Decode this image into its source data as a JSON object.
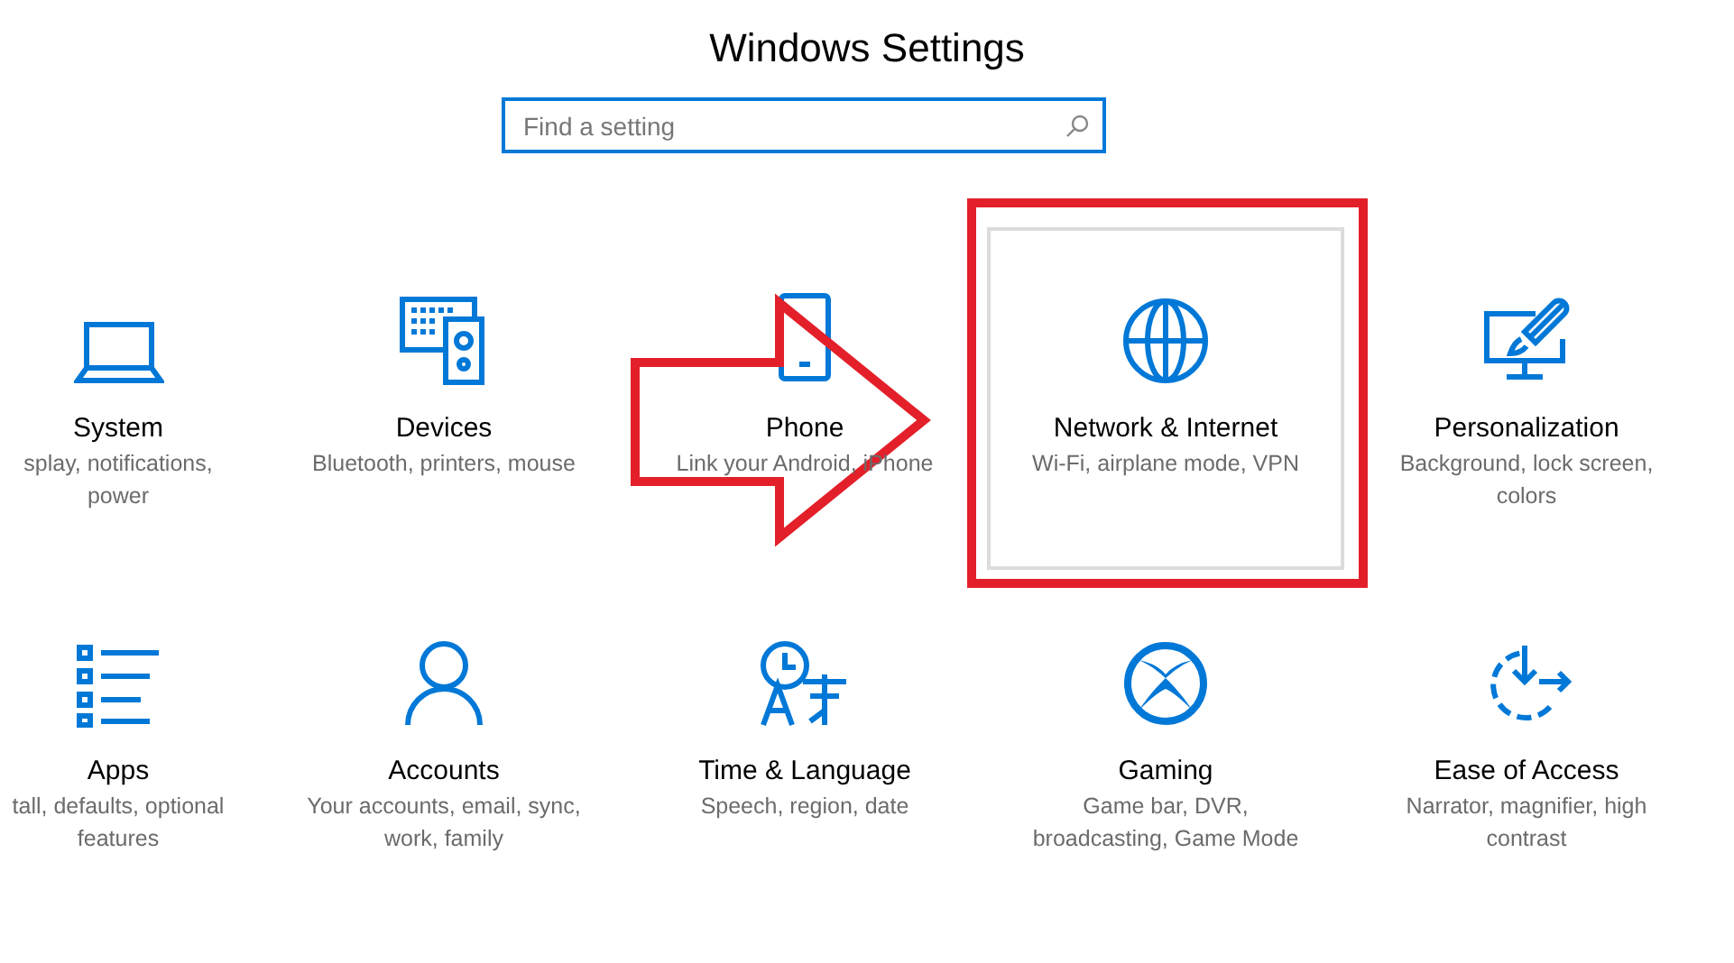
{
  "window": {
    "title": "Windows Settings"
  },
  "search": {
    "placeholder": "Find a setting"
  },
  "tiles": [
    {
      "title": "System",
      "description": "splay, notifications, power",
      "selected": false,
      "annotated": false
    },
    {
      "title": "Devices",
      "description": "Bluetooth, printers, mouse",
      "selected": false,
      "annotated": false
    },
    {
      "title": "Phone",
      "description": "Link your Android, iPhone",
      "selected": false,
      "annotated": false
    },
    {
      "title": "Network & Internet",
      "description": "Wi-Fi, airplane mode, VPN",
      "selected": true,
      "annotated": true
    },
    {
      "title": "Personalization",
      "description": "Background, lock screen, colors",
      "selected": false,
      "annotated": false
    },
    {
      "title": "Apps",
      "description": "tall, defaults, optional features",
      "selected": false,
      "annotated": false
    },
    {
      "title": "Accounts",
      "description": "Your accounts, email, sync, work, family",
      "selected": false,
      "annotated": false
    },
    {
      "title": "Time & Language",
      "description": "Speech, region, date",
      "selected": false,
      "annotated": false
    },
    {
      "title": "Gaming",
      "description": "Game bar, DVR, broadcasting, Game Mode",
      "selected": false,
      "annotated": false
    },
    {
      "title": "Ease of Access",
      "description": "Narrator, magnifier, high contrast",
      "selected": false,
      "annotated": false
    }
  ],
  "annotations": [
    {
      "kind": "arrow"
    }
  ]
}
